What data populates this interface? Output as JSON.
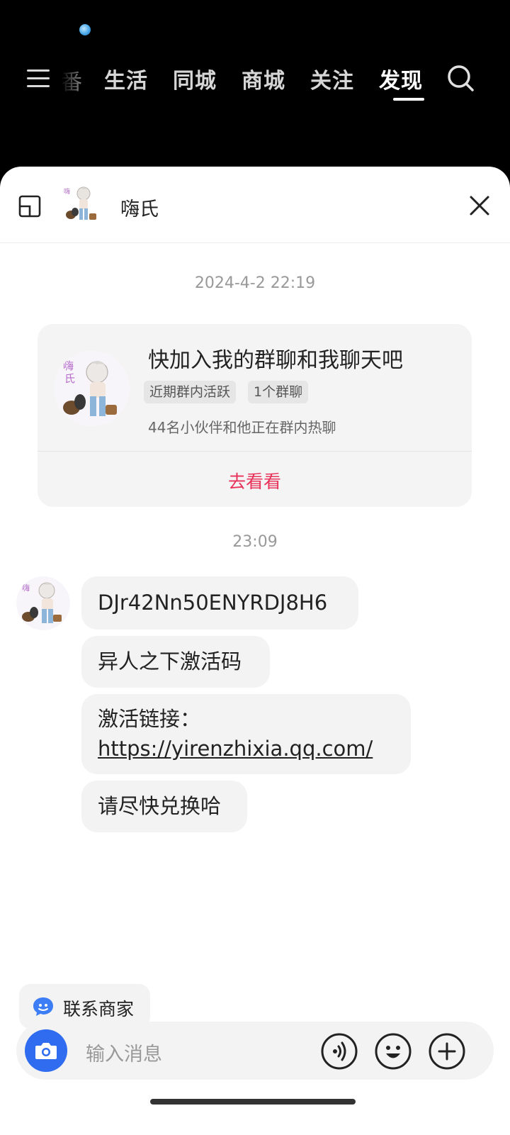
{
  "topnav": {
    "items": [
      "番",
      "生活",
      "同城",
      "商城",
      "关注",
      "发现"
    ],
    "active_index": 5
  },
  "chat": {
    "contact_name": "嗨氏",
    "timestamp_1": "2024-4-2 22:19",
    "group_card": {
      "title": "快加入我的群聊和我聊天吧",
      "tags": [
        "近期群内活跃",
        "1个群聊"
      ],
      "subtitle": "44名小伙伴和他正在群内热聊",
      "action_label": "去看看"
    },
    "timestamp_2": "23:09",
    "messages": [
      "DJr42Nn50ENYRDJ8H6",
      "异人之下激活码",
      "激活链接：",
      "https://yirenzhixia.qq.com/",
      "请尽快兑换哈"
    ]
  },
  "footer": {
    "contact_merchant_label": "联系商家",
    "input_placeholder": "输入消息"
  },
  "colors": {
    "accent_red": "#e8325a",
    "camera_blue": "#2f6cf0"
  },
  "icons": [
    "menu-icon",
    "search-icon",
    "restore-window-icon",
    "close-icon",
    "chat-bubble-icon",
    "camera-icon",
    "voice-icon",
    "emoji-icon",
    "plus-icon"
  ]
}
